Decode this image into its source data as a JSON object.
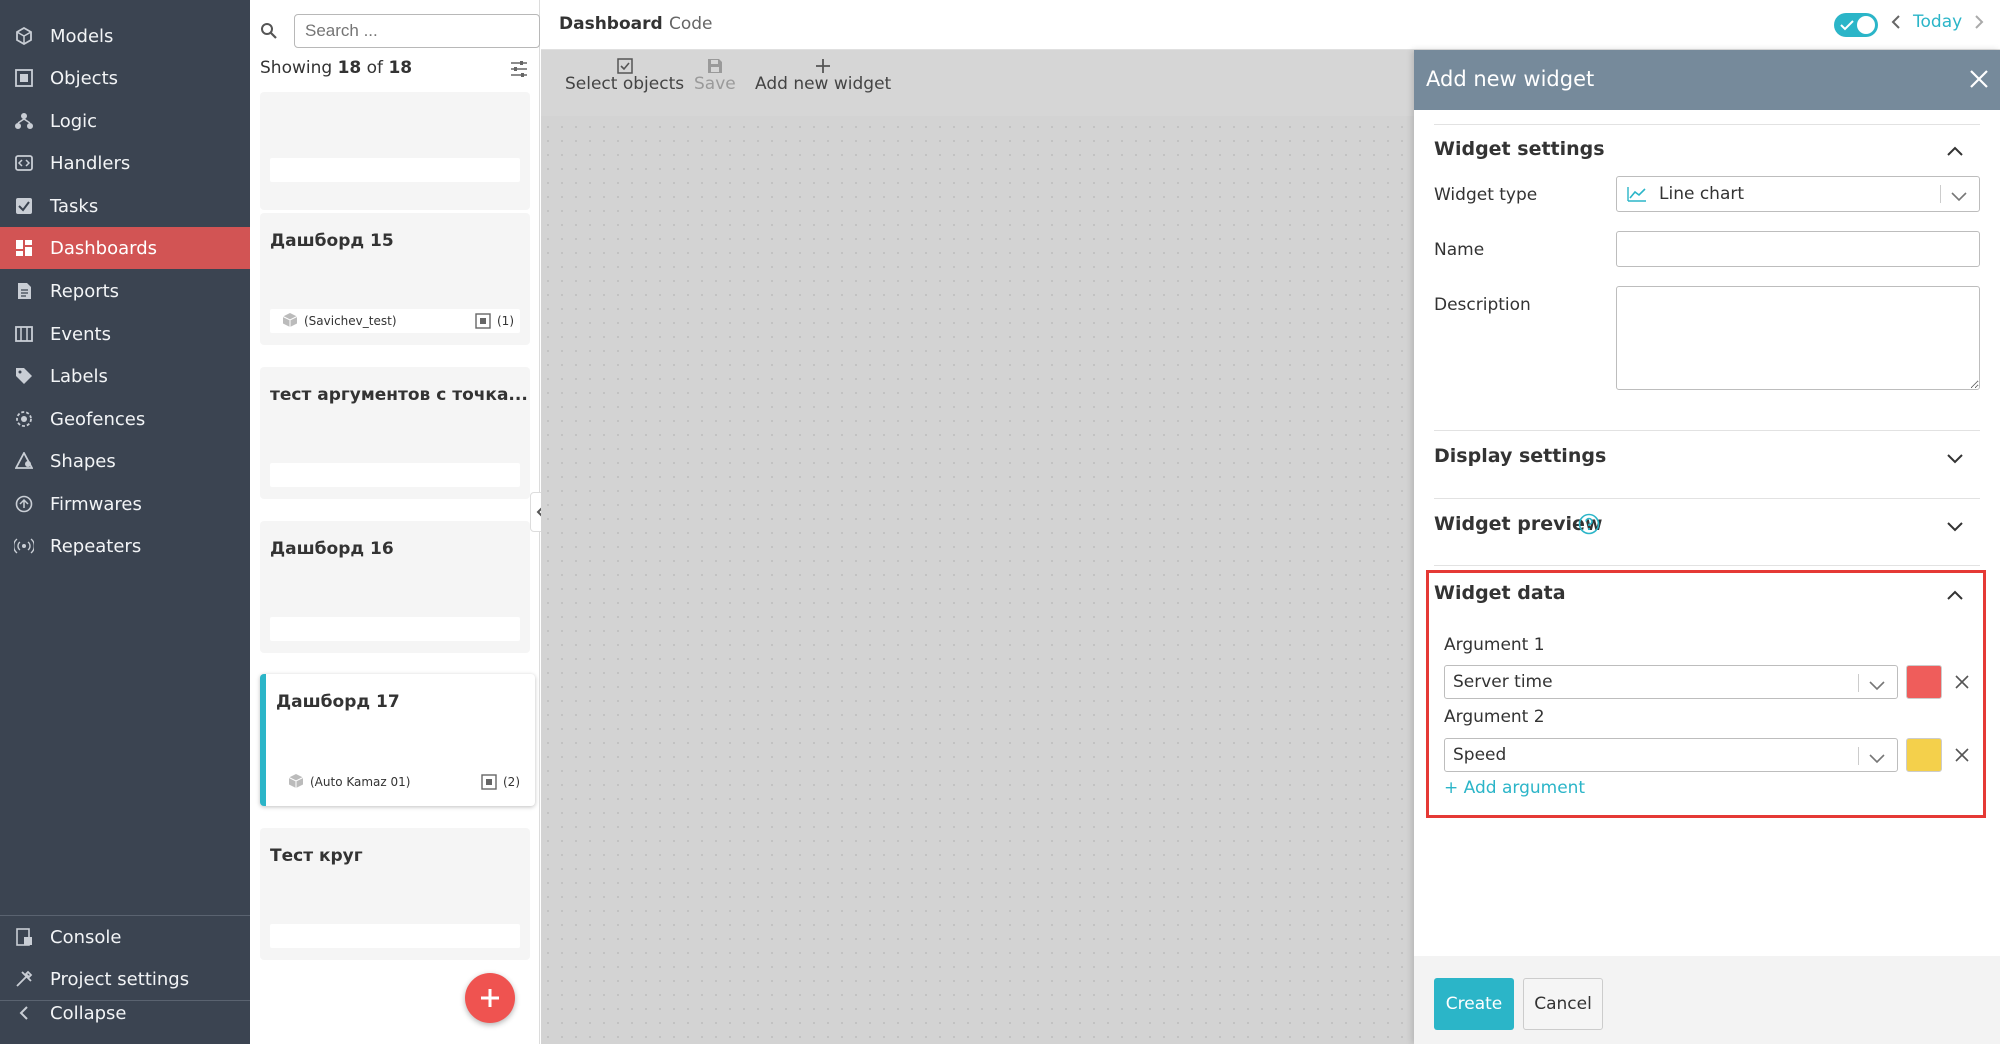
{
  "sidebar": {
    "items": [
      {
        "label": "Models",
        "icon": "cube-icon"
      },
      {
        "label": "Objects",
        "icon": "object-icon"
      },
      {
        "label": "Logic",
        "icon": "logic-icon"
      },
      {
        "label": "Handlers",
        "icon": "handler-icon"
      },
      {
        "label": "Tasks",
        "icon": "tasks-icon"
      },
      {
        "label": "Dashboards",
        "icon": "dashboard-icon",
        "active": true
      },
      {
        "label": "Reports",
        "icon": "report-icon"
      },
      {
        "label": "Events",
        "icon": "events-icon"
      },
      {
        "label": "Labels",
        "icon": "label-icon"
      },
      {
        "label": "Geofences",
        "icon": "geofence-icon"
      },
      {
        "label": "Shapes",
        "icon": "shapes-icon"
      },
      {
        "label": "Firmwares",
        "icon": "firmware-icon"
      },
      {
        "label": "Repeaters",
        "icon": "repeater-icon"
      }
    ],
    "bottom": [
      {
        "label": "Console",
        "icon": "console-icon"
      },
      {
        "label": "Project settings",
        "icon": "settings-icon"
      },
      {
        "label": "Collapse",
        "icon": "chevron-left-icon"
      }
    ]
  },
  "list": {
    "search_placeholder": "Search ...",
    "showing_prefix": "Showing",
    "showing_count": "18",
    "showing_of": "of",
    "showing_total": "18",
    "cards": [
      {
        "title": "",
        "object": "",
        "count": ""
      },
      {
        "title": "Дашборд 15",
        "object": "(Savichev_test)",
        "count": "(1)"
      },
      {
        "title": "тест аргументов с точка...",
        "object": "",
        "count": ""
      },
      {
        "title": "Дашборд 16",
        "object": "",
        "count": ""
      },
      {
        "title": "Дашборд 17",
        "object": "(Auto Kamaz 01)",
        "count": "(2)",
        "selected": true
      },
      {
        "title": "Тест круг",
        "object": "",
        "count": ""
      }
    ]
  },
  "topbar": {
    "tabs": [
      "Dashboard",
      "Code"
    ],
    "today_label": "Today",
    "toggle_on": true
  },
  "toolbar": {
    "select_objects": "Select objects",
    "save": "Save",
    "add_widget": "Add new widget"
  },
  "panel": {
    "title": "Add new widget",
    "widget_settings": {
      "title": "Widget settings",
      "type_label": "Widget type",
      "type_value": "Line chart",
      "name_label": "Name",
      "name_value": "",
      "description_label": "Description",
      "description_value": ""
    },
    "display_settings": {
      "title": "Display settings"
    },
    "widget_preview": {
      "title": "Widget preview"
    },
    "widget_data": {
      "title": "Widget data",
      "arguments": [
        {
          "label": "Argument 1",
          "value": "Server time",
          "color": "#ef5d5b"
        },
        {
          "label": "Argument 2",
          "value": "Speed",
          "color": "#f4d04b"
        }
      ],
      "add_argument": "+ Add argument"
    },
    "create": "Create",
    "cancel": "Cancel"
  },
  "colors": {
    "accent": "#2bb5c8",
    "sidebar_bg": "#3b4451",
    "active_nav": "#d25454",
    "panel_header": "#768a9b",
    "highlight_border": "#e53935"
  }
}
